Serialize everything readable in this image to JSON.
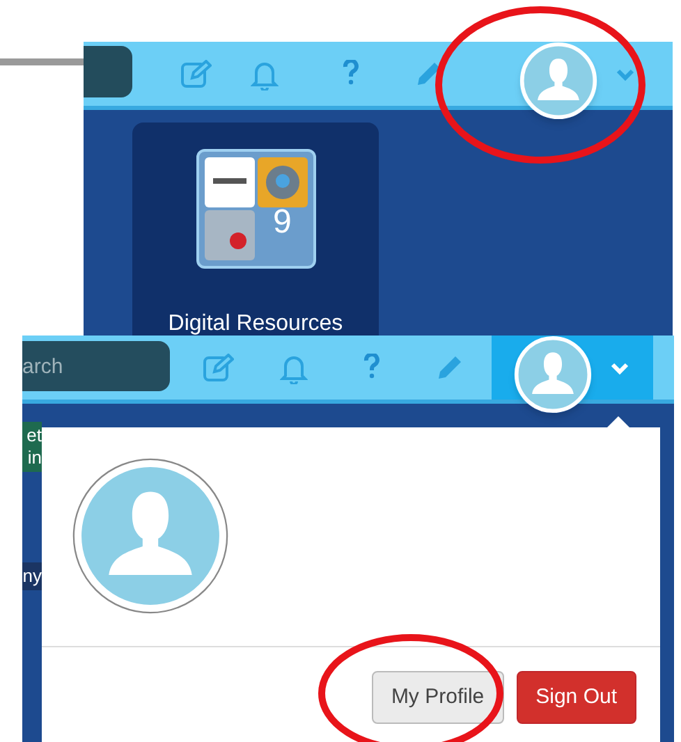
{
  "top_panel": {
    "menu_open": false,
    "card": {
      "count": "9",
      "label": "Digital Resources"
    }
  },
  "bottom_panel": {
    "menu_open": true,
    "search": {
      "placeholder": "arch"
    },
    "side_tiles": [
      {
        "lines": [
          "et",
          "in"
        ],
        "color": "#1e6a4f"
      },
      {
        "lines": [
          "ny"
        ],
        "color": "#1b3563"
      }
    ],
    "menu": {
      "buttons": [
        {
          "label": "My Profile",
          "kind": "default"
        },
        {
          "label": "Sign Out",
          "kind": "danger"
        }
      ]
    }
  }
}
